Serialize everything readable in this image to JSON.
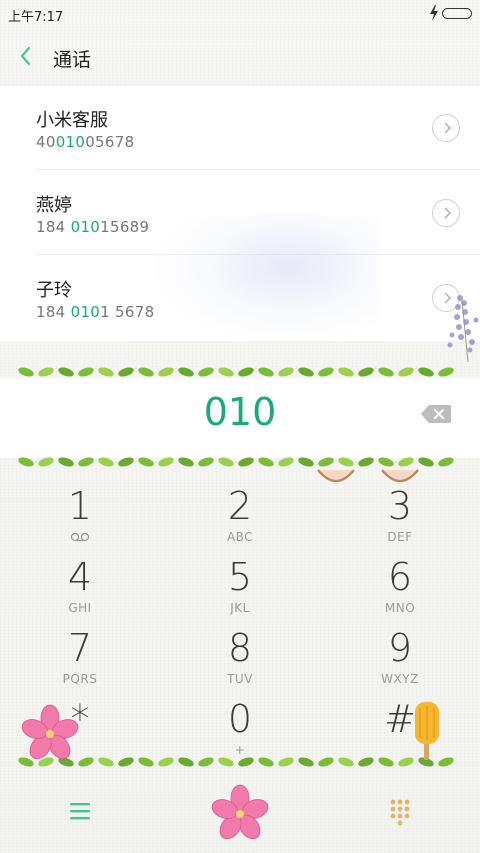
{
  "status_bar": {
    "time": "上午7:17"
  },
  "header": {
    "title": "通话"
  },
  "results": [
    {
      "name": "小米客服",
      "num_pre": "40",
      "num_hl": "010",
      "num_post": "05678"
    },
    {
      "name": "燕婷",
      "num_pre": "184 ",
      "num_hl": "010",
      "num_post": "15689"
    },
    {
      "name": "子玲",
      "num_pre": "184 ",
      "num_hl": "010",
      "num_post": "1 5678"
    }
  ],
  "input": {
    "digits": "010"
  },
  "keypad": [
    {
      "digit": "1",
      "letters": ""
    },
    {
      "digit": "2",
      "letters": "ABC"
    },
    {
      "digit": "3",
      "letters": "DEF"
    },
    {
      "digit": "4",
      "letters": "GHI"
    },
    {
      "digit": "5",
      "letters": "JKL"
    },
    {
      "digit": "6",
      "letters": "MNO"
    },
    {
      "digit": "7",
      "letters": "PQRS"
    },
    {
      "digit": "8",
      "letters": "TUV"
    },
    {
      "digit": "9",
      "letters": "WXYZ"
    },
    {
      "digit": "*",
      "letters": ""
    },
    {
      "digit": "0",
      "letters": "+"
    },
    {
      "digit": "#",
      "letters": ""
    }
  ],
  "colors": {
    "accent": "#1ba97c",
    "vine": "#8cc63f",
    "flower": "#f06aa0"
  }
}
